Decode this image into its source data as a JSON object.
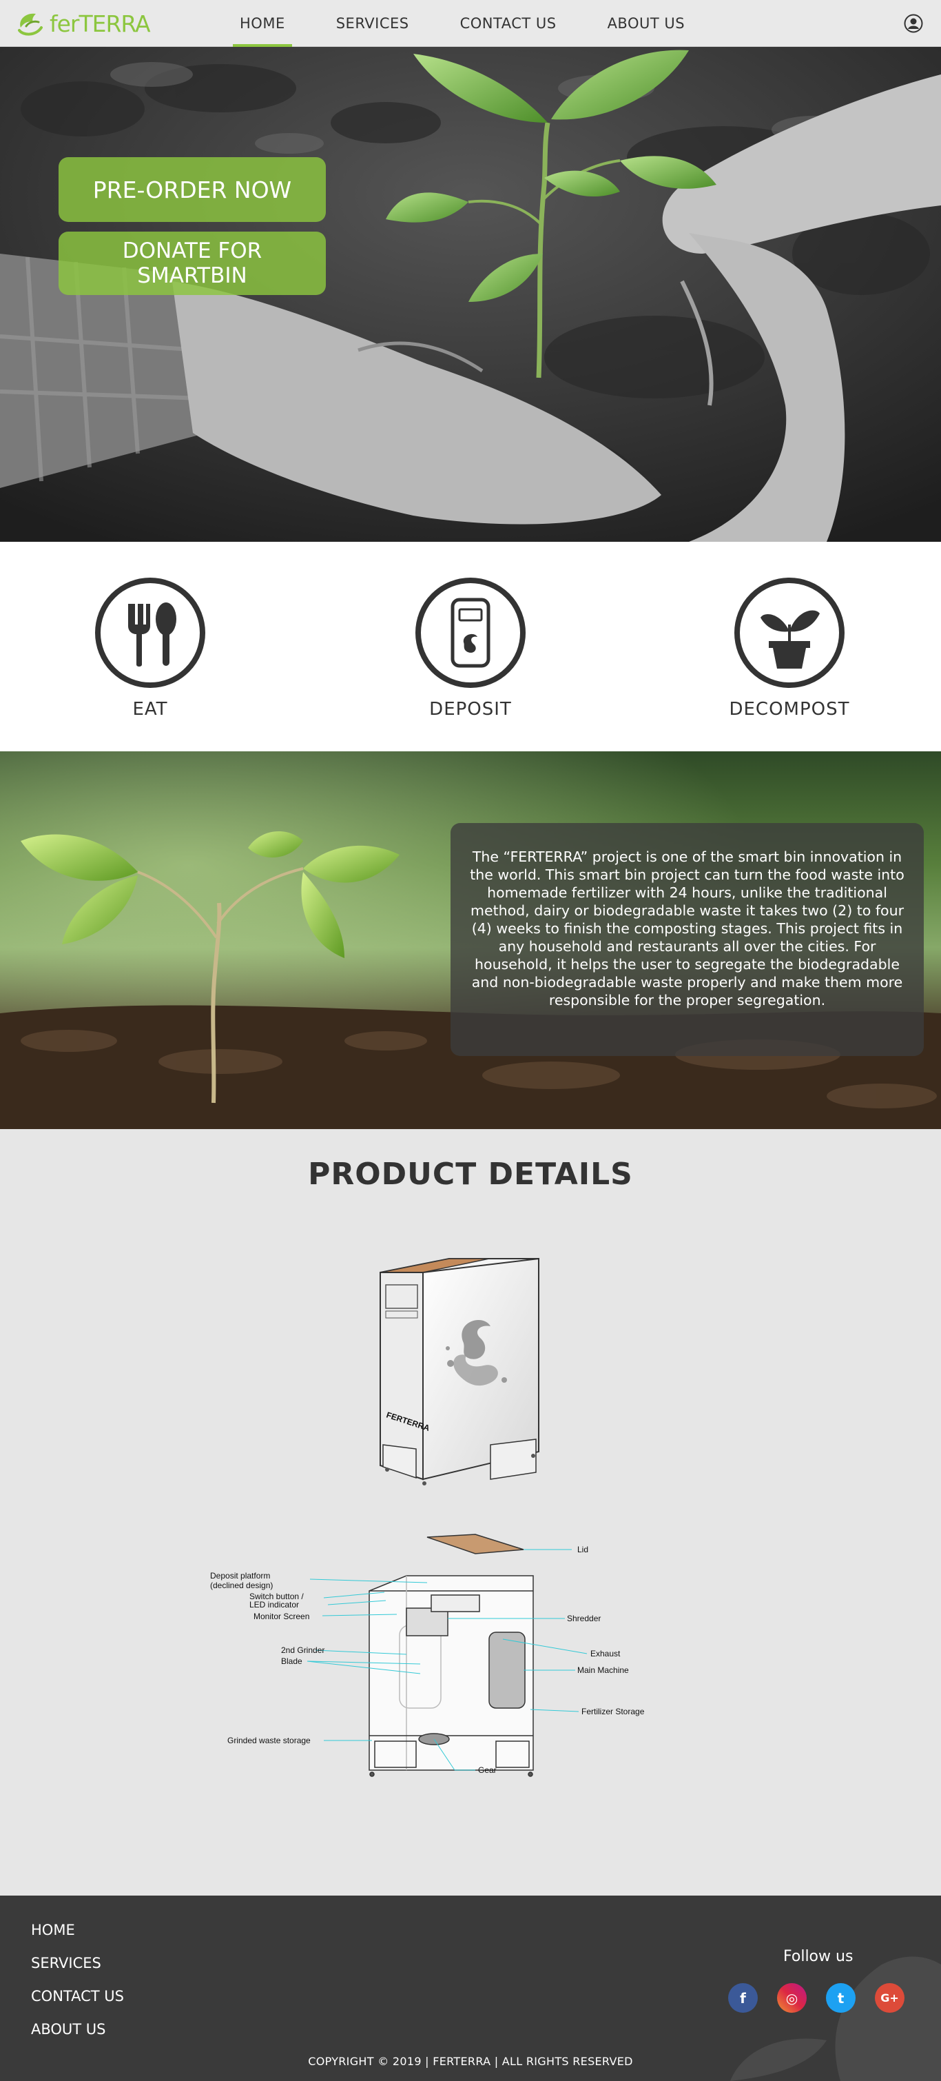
{
  "brand": {
    "name": "ferTERRA",
    "accent": "#8cc63f"
  },
  "nav": {
    "items": [
      {
        "label": "HOME",
        "active": true
      },
      {
        "label": "SERVICES",
        "active": false
      },
      {
        "label": "CONTACT US",
        "active": false
      },
      {
        "label": "ABOUT US",
        "active": false
      }
    ],
    "profile_icon": "user-circle-icon"
  },
  "hero": {
    "preorder_label": "PRE-ORDER NOW",
    "donate_label_line1": "DONATE FOR",
    "donate_label_line2": "SMARTBIN"
  },
  "steps": [
    {
      "label": "EAT",
      "icon": "fork-spoon-icon"
    },
    {
      "label": "DEPOSIT",
      "icon": "smartbin-device-icon"
    },
    {
      "label": "DECOMPOST",
      "icon": "plant-pot-icon"
    }
  ],
  "about": {
    "text": "The “FERTERRA” project is one of the smart bin innovation in the world. This smart bin project can turn the food waste into homemade fertilizer with 24 hours, unlike the traditional method, dairy or biodegradable waste it takes two (2) to four (4) weeks to finish the composting stages. This project fits in any household and restaurants all over the cities. For household, it helps the user to segregate the biodegradable and non-biodegradable waste properly and make them more responsible for the proper segregation."
  },
  "product": {
    "title": "PRODUCT DETAILS",
    "bin_brand": "FERTERRA",
    "diagram_labels": {
      "lid": "Lid",
      "deposit_platform_1": "Deposit platform",
      "deposit_platform_2": "(declined design)",
      "switch_1": "Switch button /",
      "switch_2": "LED indicator",
      "monitor": "Monitor Screen",
      "shredder": "Shredder",
      "grinder2": "2nd Grinder",
      "exhaust": "Exhaust",
      "blade": "Blade",
      "main_machine": "Main Machine",
      "fertilizer": "Fertilizer Storage",
      "grinded": "Grinded waste storage",
      "gear": "Gear"
    }
  },
  "footer": {
    "links": [
      "HOME",
      "SERVICES",
      "CONTACT US",
      "ABOUT US"
    ],
    "follow_label": "Follow us",
    "socials": [
      {
        "name": "facebook",
        "glyph": "f",
        "color": "#3b5998"
      },
      {
        "name": "instagram",
        "glyph": "◎",
        "color": "#c13584"
      },
      {
        "name": "twitter",
        "glyph": "t",
        "color": "#1da1f2"
      },
      {
        "name": "google-plus",
        "glyph": "G+",
        "color": "#dd4b39"
      }
    ],
    "copyright": "COPYRIGHT © 2019 | FERTERRA | ALL RIGHTS RESERVED"
  }
}
